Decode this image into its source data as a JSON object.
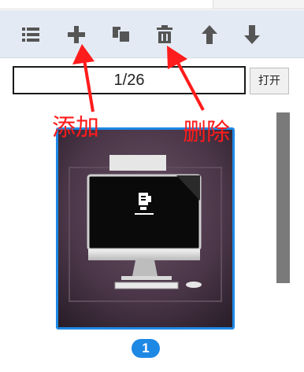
{
  "toolbar": {
    "buttons": [
      {
        "icon": "list-icon"
      },
      {
        "icon": "plus-icon"
      },
      {
        "icon": "copy-icon"
      },
      {
        "icon": "trash-icon"
      },
      {
        "icon": "arrow-up-icon"
      },
      {
        "icon": "arrow-down-icon"
      }
    ]
  },
  "pager": {
    "value": "1/26",
    "open_label": "打开"
  },
  "annotations": {
    "add_label": "添加",
    "delete_label": "删除",
    "color": "#ff1c1c"
  },
  "slides": [
    {
      "number": "1",
      "selected": true
    }
  ],
  "colors": {
    "toolbar_bg": "#e4eaf3",
    "icon": "#555555",
    "selection": "#1e88e5"
  }
}
